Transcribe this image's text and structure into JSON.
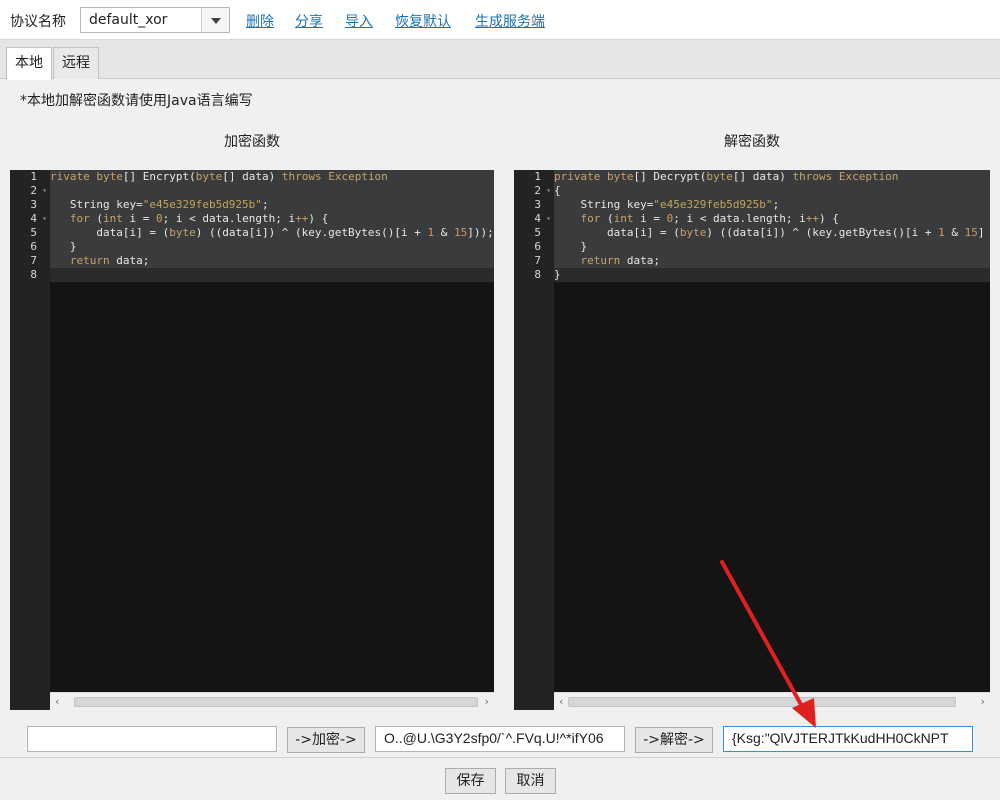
{
  "header": {
    "protocol_label": "协议名称",
    "protocol_value": "default_xor",
    "links": {
      "delete": "删除",
      "share": "分享",
      "import": "导入",
      "restore": "恢复默认",
      "generate": "生成服务端"
    }
  },
  "tabs": {
    "local": "本地",
    "remote": "远程"
  },
  "note": "*本地加解密函数请使用Java语言编写",
  "encrypt_title": "加密函数",
  "decrypt_title": "解密函数",
  "gutter_lines": [
    "1",
    "2",
    "3",
    "4",
    "5",
    "6",
    "7",
    "8"
  ],
  "encrypt_code": {
    "l1_a": "rivate ",
    "l1_b": "byte",
    "l1_c": "[] Encrypt(",
    "l1_d": "byte",
    "l1_e": "[] data) ",
    "l1_f": "throws",
    "l1_g": " ",
    "l1_h": "Exception",
    "l3_a": "   String key=",
    "l3_b": "\"e45e329feb5d925b\"",
    "l3_c": ";",
    "l4_a": "   ",
    "l4_b": "for",
    "l4_c": " (",
    "l4_d": "int",
    "l4_e": " i = ",
    "l4_f": "0",
    "l4_g": "; i < data.length; i",
    "l4_h": "++",
    "l4_i": ") {",
    "l5_a": "       data[i] = (",
    "l5_b": "byte",
    "l5_c": ") ((data[i]) ^ (key.getBytes()[i + ",
    "l5_d": "1",
    "l5_e": " & ",
    "l5_f": "15",
    "l5_g": "]));",
    "l6": "   }",
    "l7_a": "   ",
    "l7_b": "return",
    "l7_c": " data;"
  },
  "decrypt_code": {
    "l1_a": "private ",
    "l1_b": "byte",
    "l1_c": "[] Decrypt(",
    "l1_d": "byte",
    "l1_e": "[] data) ",
    "l1_f": "throws",
    "l1_g": " ",
    "l1_h": "Exception",
    "l2": "{",
    "l3_a": "    String key=",
    "l3_b": "\"e45e329feb5d925b\"",
    "l3_c": ";",
    "l4_a": "    ",
    "l4_b": "for",
    "l4_c": " (",
    "l4_d": "int",
    "l4_e": " i = ",
    "l4_f": "0",
    "l4_g": "; i < data.length; i",
    "l4_h": "++",
    "l4_i": ") {",
    "l5_a": "        data[i] = (",
    "l5_b": "byte",
    "l5_c": ") ((data[i]) ^ (key.getBytes()[i + ",
    "l5_d": "1",
    "l5_e": " & ",
    "l5_f": "15",
    "l5_g": "]",
    "l6": "    }",
    "l7_a": "    ",
    "l7_b": "return",
    "l7_c": " data;",
    "l8": "}"
  },
  "bottom": {
    "plain_input": "",
    "encrypt_button": "->加密->",
    "cipher_value": "O..@U.\\G3Y2sfp0/`^.FVq.U!^*ifY06",
    "decrypt_button": "->解密->",
    "decrypted_value": "{Ksg:\"QlVJTERJTkKudHH0CkNPT"
  },
  "footer": {
    "save": "保存",
    "cancel": "取消"
  },
  "colors": {
    "annotation_arrow": "#e02020",
    "link": "#1a73b8"
  }
}
